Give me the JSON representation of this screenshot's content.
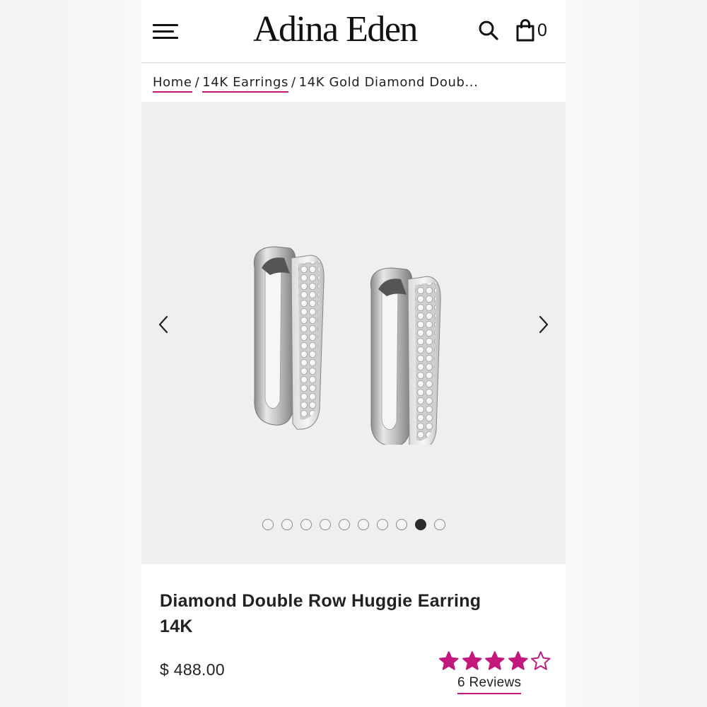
{
  "header": {
    "brand": "Adina Eden",
    "cart_count": "0"
  },
  "breadcrumb": {
    "items": [
      {
        "label": "Home"
      },
      {
        "label": "14K Earrings"
      },
      {
        "label": "14K Gold Diamond Doub..."
      }
    ],
    "separator": "/"
  },
  "gallery": {
    "image_count": 10,
    "active_index": 8
  },
  "product": {
    "title": "Diamond Double Row Huggie Earring 14K",
    "price": "$ 488.00",
    "rating": 4,
    "rating_max": 5,
    "reviews_label": "6 Reviews"
  },
  "colors": {
    "accent": "#c2187e",
    "text": "#222222",
    "dot_active": "#2b2b2b"
  }
}
